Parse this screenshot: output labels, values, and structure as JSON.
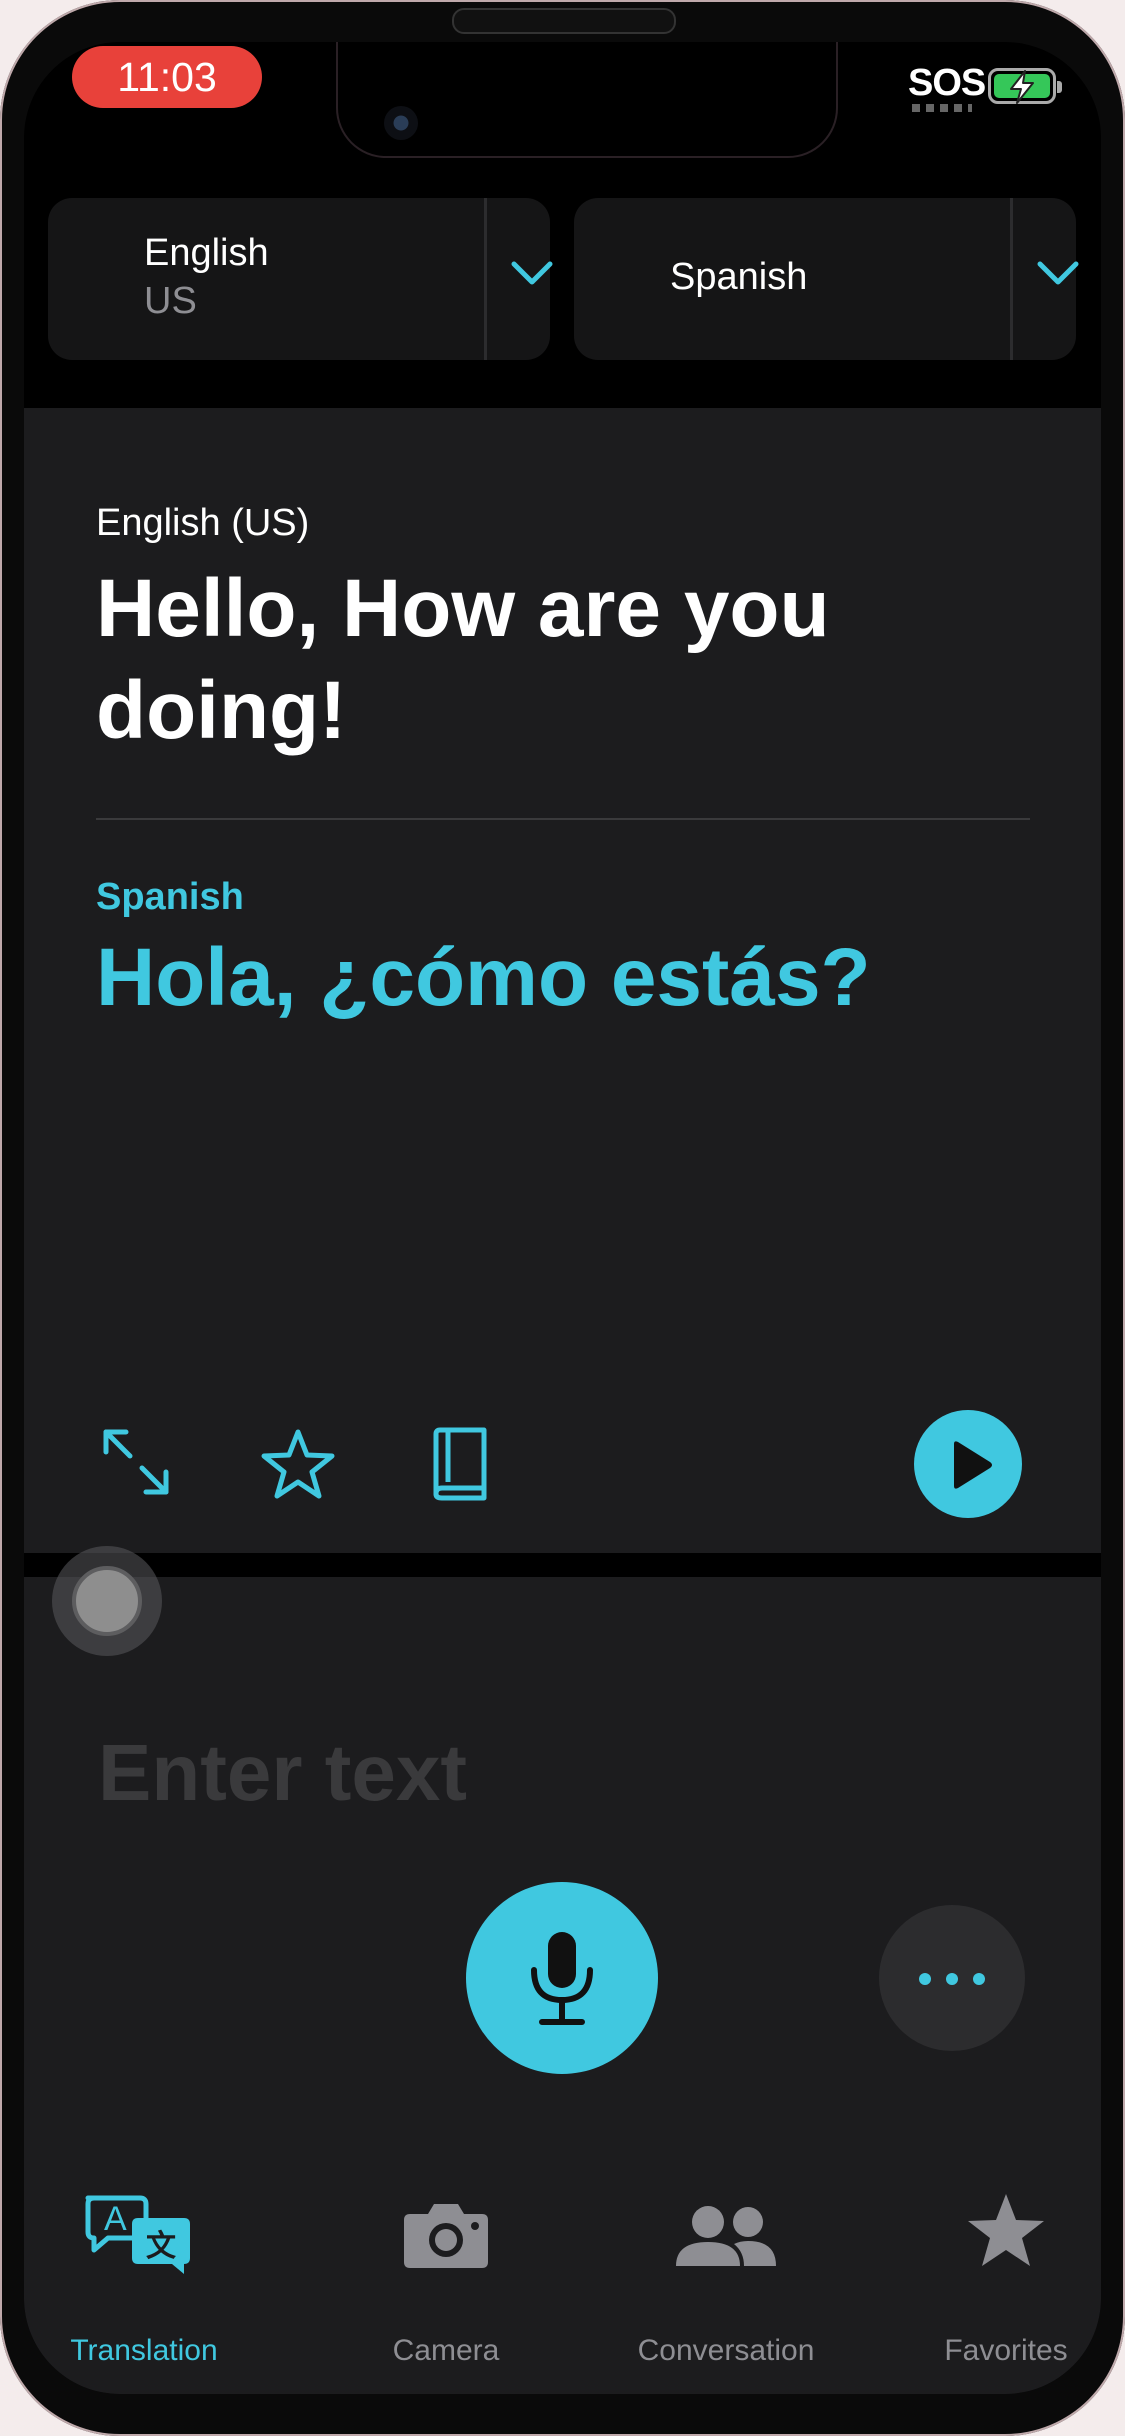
{
  "status": {
    "time": "11:03",
    "sos": "SOS"
  },
  "languages": {
    "source": {
      "name": "English",
      "region": "US"
    },
    "target": {
      "name": "Spanish"
    }
  },
  "translation": {
    "source_label": "English (US)",
    "source_text": "Hello, How are you doing!",
    "target_label": "Spanish",
    "target_text": "Hola, ¿cómo estás?"
  },
  "input": {
    "placeholder": "Enter text"
  },
  "tabs": [
    {
      "label": "Translation",
      "icon": "translation-icon",
      "active": true
    },
    {
      "label": "Camera",
      "icon": "camera-icon",
      "active": false
    },
    {
      "label": "Conversation",
      "icon": "conversation-icon",
      "active": false
    },
    {
      "label": "Favorites",
      "icon": "star-icon",
      "active": false
    }
  ],
  "colors": {
    "accent": "#40c8e0",
    "background": "#000000",
    "card": "#1c1c1e",
    "status_pill": "#e8413a",
    "battery": "#35c759"
  }
}
